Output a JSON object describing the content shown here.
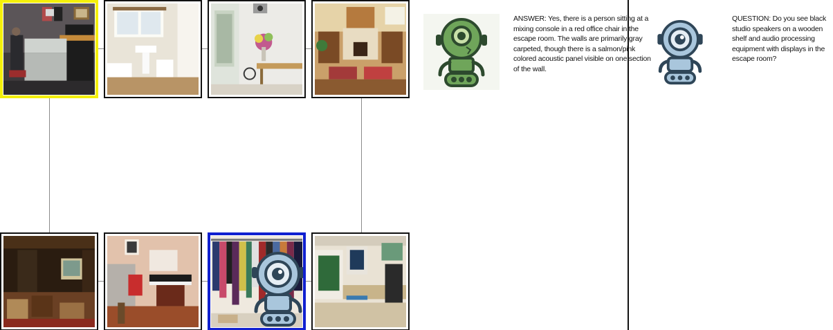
{
  "dialogue": {
    "answer": "ANSWER: Yes, there is a person sitting at a mixing console in a red office chair in the escape room. The walls are primarily gray carpeted, though there is a salmon/pink colored acoustic panel visible on one section of the wall.",
    "question": "QUESTION: Do you see black studio speakers on a wooden shelf and audio processing equipment with displays in the escape room?"
  },
  "rooms": [
    {
      "name": "recording-studio",
      "marker": "current-room",
      "border_color": "#f4f00a"
    },
    {
      "name": "bathroom"
    },
    {
      "name": "hallway-with-flowers"
    },
    {
      "name": "living-room-fireplace"
    },
    {
      "name": "home-theater"
    },
    {
      "name": "music-room-keyboard"
    },
    {
      "name": "closet-clothes-rack",
      "marker": "agent-location",
      "border_color": "#1020d0"
    },
    {
      "name": "computer-lab"
    }
  ],
  "icons": {
    "answerer": "green-robot-icon",
    "asker": "blue-robot-icon"
  },
  "colors": {
    "current_room": "#f4f00a",
    "agent_room": "#1020d0",
    "answerer_robot": "#6fa55a",
    "asker_robot": "#a9c6dc"
  }
}
